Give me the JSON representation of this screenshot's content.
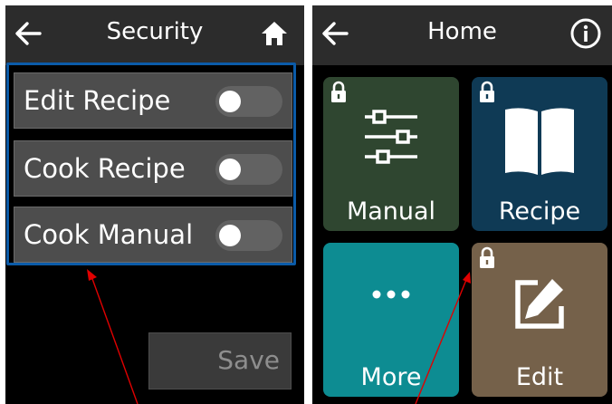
{
  "security_screen": {
    "title": "Security",
    "back_icon": "arrow-left-icon",
    "home_icon": "home-icon",
    "items": [
      {
        "label": "Edit Recipe",
        "enabled": false
      },
      {
        "label": "Cook Recipe",
        "enabled": false
      },
      {
        "label": "Cook Manual",
        "enabled": false
      }
    ],
    "save_label": "Save",
    "group_border_color": "#0b5ba8"
  },
  "home_screen": {
    "title": "Home",
    "back_icon": "arrow-left-icon",
    "info_icon": "info-icon",
    "tiles": [
      {
        "label": "Manual",
        "icon": "sliders-icon",
        "locked": true,
        "color": "#2f4630"
      },
      {
        "label": "Recipe",
        "icon": "book-icon",
        "locked": true,
        "color": "#0f3a55"
      },
      {
        "label": "More",
        "icon": "more-dots-icon",
        "locked": false,
        "color": "#0d8c92"
      },
      {
        "label": "Edit",
        "icon": "edit-icon",
        "locked": true,
        "color": "#75614a"
      }
    ]
  },
  "annotation": {
    "arrow_color": "#e00000"
  }
}
